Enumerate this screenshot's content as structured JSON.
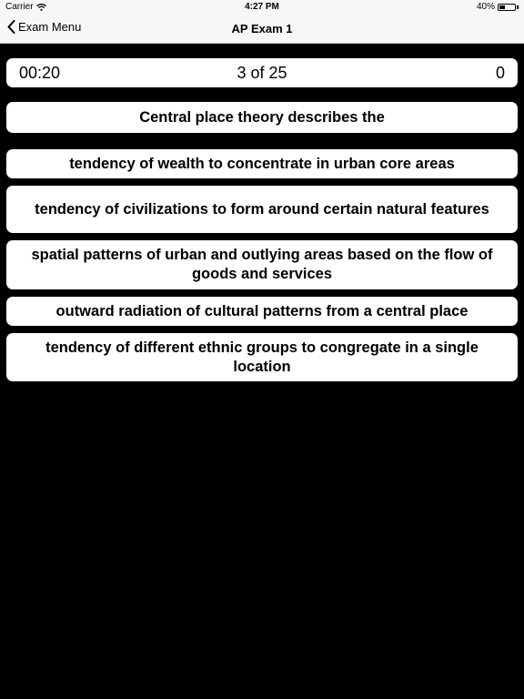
{
  "status_bar": {
    "carrier": "Carrier",
    "time": "4:27 PM",
    "battery_text": "40%",
    "battery_level": 0.4
  },
  "nav": {
    "back_label": "Exam Menu",
    "title": "AP Exam 1"
  },
  "quiz": {
    "timer": "00:20",
    "progress": "3 of 25",
    "score": "0",
    "question": "Central place theory describes the",
    "answers": [
      "tendency of wealth to concentrate in urban core areas",
      "tendency of civilizations to form around certain natural features",
      "spatial patterns of urban and outlying areas based on the flow of goods and services",
      "outward radiation of cultural patterns from a central place",
      "tendency of different ethnic groups to congregate in a single location"
    ]
  },
  "colors": {
    "background": "#000000",
    "card": "#ffffff",
    "bar": "#f7f7f7"
  }
}
